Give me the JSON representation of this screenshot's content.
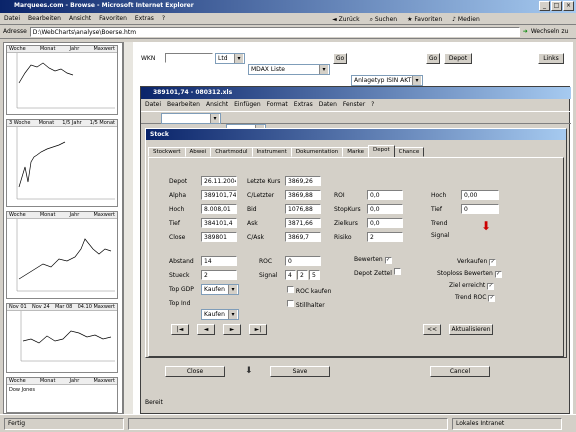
{
  "browser": {
    "title": "Marquees.com - Browse - Microsoft Internet Explorer",
    "menu": [
      "Datei",
      "Bearbeiten",
      "Ansicht",
      "Favoriten",
      "Extras",
      "?"
    ],
    "toolbar": {
      "back": "Zurück",
      "search": "Suchen",
      "favorites": "Favoriten",
      "media": "Medien"
    },
    "address_label": "Adresse",
    "address_value": "D:\\WebCharts\\analyse\\Boerse.htm",
    "go_label": "Wechseln zu"
  },
  "mini_charts": [
    {
      "headers": [
        "Woche",
        "Monat",
        "Jahr",
        "Maxwert"
      ]
    },
    {
      "headers": [
        "3 Woche",
        "Monat",
        "1/5 Jahr",
        "1/5 Monat"
      ]
    },
    {
      "headers": [
        "Woche",
        "Monat",
        "Jahr",
        "Maxwert"
      ]
    },
    {
      "headers": [
        "Nov 01",
        "Nov 24",
        "Mar 08",
        "04.10 Maxwert"
      ]
    },
    {
      "headers": [
        "Woche",
        "Monat",
        "Jahr",
        "Maxwert"
      ]
    }
  ],
  "left_caption": "Dow Jones",
  "query": {
    "label": "WKN",
    "value": "",
    "sel1": "Ltd",
    "sel2": "MDAX Liste",
    "go1": "Go",
    "sel3": "Anlagetyp ISIN AKTIE",
    "go2": "Go",
    "depot": "Depot",
    "links": "Links"
  },
  "excel": {
    "title": "389101,74 - 080312.xls",
    "menu": [
      "Datei",
      "Bearbeiten",
      "Ansicht",
      "Einfügen",
      "Format",
      "Extras",
      "Daten",
      "Fenster",
      "?"
    ]
  },
  "form": {
    "title": "Stock",
    "tabs": [
      "Stockwert",
      "Abwei",
      "Chartmodul",
      "Instrument",
      "Dokumentation",
      "Marke",
      "Depot",
      "Chance"
    ],
    "active_tab": 6,
    "left_fields": [
      {
        "label": "Depot",
        "value": "26.11.2004"
      },
      {
        "label": "Alpha",
        "value": "389101,74"
      },
      {
        "label": "Hoch",
        "value": "8.008,01"
      },
      {
        "label": "Tief",
        "value": "384101,4"
      },
      {
        "label": "Close",
        "value": "389801"
      }
    ],
    "mid_fields": [
      {
        "label": "Letzte Kurs",
        "value": "3869,26"
      },
      {
        "label": "C/Letzter",
        "value": "3869,88"
      },
      {
        "label": "Bid",
        "value": "1076,88"
      },
      {
        "label": "Ask",
        "value": "3871,66"
      },
      {
        "label": "C/Ask",
        "value": "3869,7"
      }
    ],
    "right_fields": [
      {
        "label": "ROI",
        "value": "0,0"
      },
      {
        "label": "StopKurs",
        "value": "0,0"
      },
      {
        "label": "Zielkurs",
        "value": "0,0"
      },
      {
        "label": "Risiko",
        "value": "2"
      }
    ],
    "far_fields": [
      {
        "label": "Hoch",
        "value": "0,00"
      },
      {
        "label": "Tief",
        "value": "0"
      }
    ],
    "far_labels": [
      "Trend",
      "Signal"
    ],
    "row2_fields": [
      {
        "label": "Abstand",
        "value": "14"
      },
      {
        "label": "Stueck",
        "value": "2"
      }
    ],
    "row2_mid": [
      {
        "label": "ROC",
        "value": "0"
      },
      {
        "label": "Signal",
        "value": "0"
      }
    ],
    "sel_rows": [
      {
        "label": "Top GDP",
        "value": "Kaufen"
      },
      {
        "label": "Top Ind",
        "value": "Kaufen"
      }
    ],
    "checkbox_mid": [
      "ROC kaufen",
      "Stillhalter"
    ],
    "checkbox_left": [
      "Bewerten",
      "Depot Zettel"
    ],
    "checkbox_right": [
      "Verkaufen",
      "Stoploss Bewerten",
      "Ziel erreicht",
      "Trend ROC"
    ],
    "nav": [
      "|◄",
      "◄",
      "►",
      "►|"
    ],
    "page_btn": "<<",
    "update_btn": "Aktualisieren"
  },
  "bottom": {
    "btn1": "Close",
    "btn2": "Save",
    "btn3": "Cancel"
  },
  "status": {
    "left": "Fertig",
    "mid": "",
    "right": "Lokales Intranet"
  },
  "colors": {
    "accent": "#0a246a",
    "arrow": "#cc0000"
  }
}
